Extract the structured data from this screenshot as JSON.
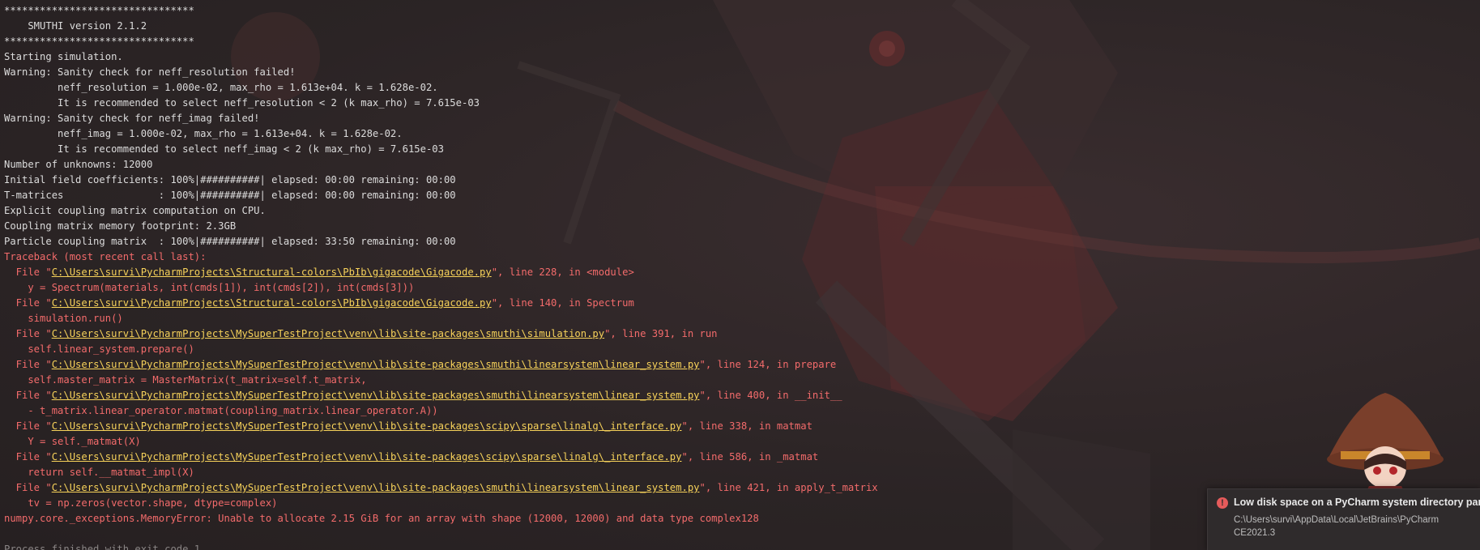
{
  "console": {
    "lines": [
      {
        "type": "normal",
        "text": "********************************"
      },
      {
        "type": "normal",
        "text": "    SMUTHI version 2.1.2"
      },
      {
        "type": "normal",
        "text": "********************************"
      },
      {
        "type": "normal",
        "text": "Starting simulation."
      },
      {
        "type": "normal",
        "text": "Warning: Sanity check for neff_resolution failed!"
      },
      {
        "type": "normal",
        "text": "         neff_resolution = 1.000e-02, max_rho = 1.613e+04. k = 1.628e-02."
      },
      {
        "type": "normal",
        "text": "         It is recommended to select neff_resolution < 2 (k max_rho) = 7.615e-03"
      },
      {
        "type": "normal",
        "text": "Warning: Sanity check for neff_imag failed!"
      },
      {
        "type": "normal",
        "text": "         neff_imag = 1.000e-02, max_rho = 1.613e+04. k = 1.628e-02."
      },
      {
        "type": "normal",
        "text": "         It is recommended to select neff_imag < 2 (k max_rho) = 7.615e-03"
      },
      {
        "type": "normal",
        "text": "Number of unknowns: 12000"
      },
      {
        "type": "normal",
        "text": "Initial field coefficients: 100%|##########| elapsed: 00:00 remaining: 00:00"
      },
      {
        "type": "normal",
        "text": "T-matrices                : 100%|##########| elapsed: 00:00 remaining: 00:00"
      },
      {
        "type": "normal",
        "text": "Explicit coupling matrix computation on CPU."
      },
      {
        "type": "normal",
        "text": "Coupling matrix memory footprint: 2.3GB"
      },
      {
        "type": "normal",
        "text": "Particle coupling matrix  : 100%|##########| elapsed: 33:50 remaining: 00:00"
      },
      {
        "type": "error",
        "text": "Traceback (most recent call last):"
      },
      {
        "type": "file",
        "pre": "  File \"",
        "path": "C:\\Users\\survi\\PycharmProjects\\Structural-colors\\PbIb\\gigacode\\Gigacode.py",
        "post": "\", line 228, in <module>"
      },
      {
        "type": "error",
        "text": "    y = Spectrum(materials, int(cmds[1]), int(cmds[2]), int(cmds[3]))"
      },
      {
        "type": "file",
        "pre": "  File \"",
        "path": "C:\\Users\\survi\\PycharmProjects\\Structural-colors\\PbIb\\gigacode\\Gigacode.py",
        "post": "\", line 140, in Spectrum"
      },
      {
        "type": "error",
        "text": "    simulation.run()"
      },
      {
        "type": "file",
        "pre": "  File \"",
        "path": "C:\\Users\\survi\\PycharmProjects\\MySuperTestProject\\venv\\lib\\site-packages\\smuthi\\simulation.py",
        "post": "\", line 391, in run"
      },
      {
        "type": "error",
        "text": "    self.linear_system.prepare()"
      },
      {
        "type": "file",
        "pre": "  File \"",
        "path": "C:\\Users\\survi\\PycharmProjects\\MySuperTestProject\\venv\\lib\\site-packages\\smuthi\\linearsystem\\linear_system.py",
        "post": "\", line 124, in prepare"
      },
      {
        "type": "error",
        "text": "    self.master_matrix = MasterMatrix(t_matrix=self.t_matrix,"
      },
      {
        "type": "file",
        "pre": "  File \"",
        "path": "C:\\Users\\survi\\PycharmProjects\\MySuperTestProject\\venv\\lib\\site-packages\\smuthi\\linearsystem\\linear_system.py",
        "post": "\", line 400, in __init__"
      },
      {
        "type": "error",
        "text": "    - t_matrix.linear_operator.matmat(coupling_matrix.linear_operator.A))"
      },
      {
        "type": "file",
        "pre": "  File \"",
        "path": "C:\\Users\\survi\\PycharmProjects\\MySuperTestProject\\venv\\lib\\site-packages\\scipy\\sparse\\linalg\\_interface.py",
        "post": "\", line 338, in matmat"
      },
      {
        "type": "error",
        "text": "    Y = self._matmat(X)"
      },
      {
        "type": "file",
        "pre": "  File \"",
        "path": "C:\\Users\\survi\\PycharmProjects\\MySuperTestProject\\venv\\lib\\site-packages\\scipy\\sparse\\linalg\\_interface.py",
        "post": "\", line 586, in _matmat"
      },
      {
        "type": "error",
        "text": "    return self.__matmat_impl(X)"
      },
      {
        "type": "file",
        "pre": "  File \"",
        "path": "C:\\Users\\survi\\PycharmProjects\\MySuperTestProject\\venv\\lib\\site-packages\\smuthi\\linearsystem\\linear_system.py",
        "post": "\", line 421, in apply_t_matrix"
      },
      {
        "type": "error",
        "text": "    tv = np.zeros(vector.shape, dtype=complex)"
      },
      {
        "type": "error",
        "text": "numpy.core._exceptions.MemoryError: Unable to allocate 2.15 GiB for an array with shape (12000, 12000) and data type complex128"
      },
      {
        "type": "normal",
        "text": ""
      },
      {
        "type": "dim",
        "text": "Process finished with exit code 1"
      }
    ]
  },
  "notification": {
    "icon": "error-icon",
    "icon_glyph": "!",
    "title": "Low disk space on a PyCharm system directory par",
    "body": "C:\\Users\\survi\\AppData\\Local\\JetBrains\\PyCharm CE2021.3"
  },
  "colors": {
    "background": "#2b2425",
    "text": "#dcdcdc",
    "error": "#f36b6b",
    "link": "#f7d25a",
    "notification_bg": "#2f2b2c"
  }
}
